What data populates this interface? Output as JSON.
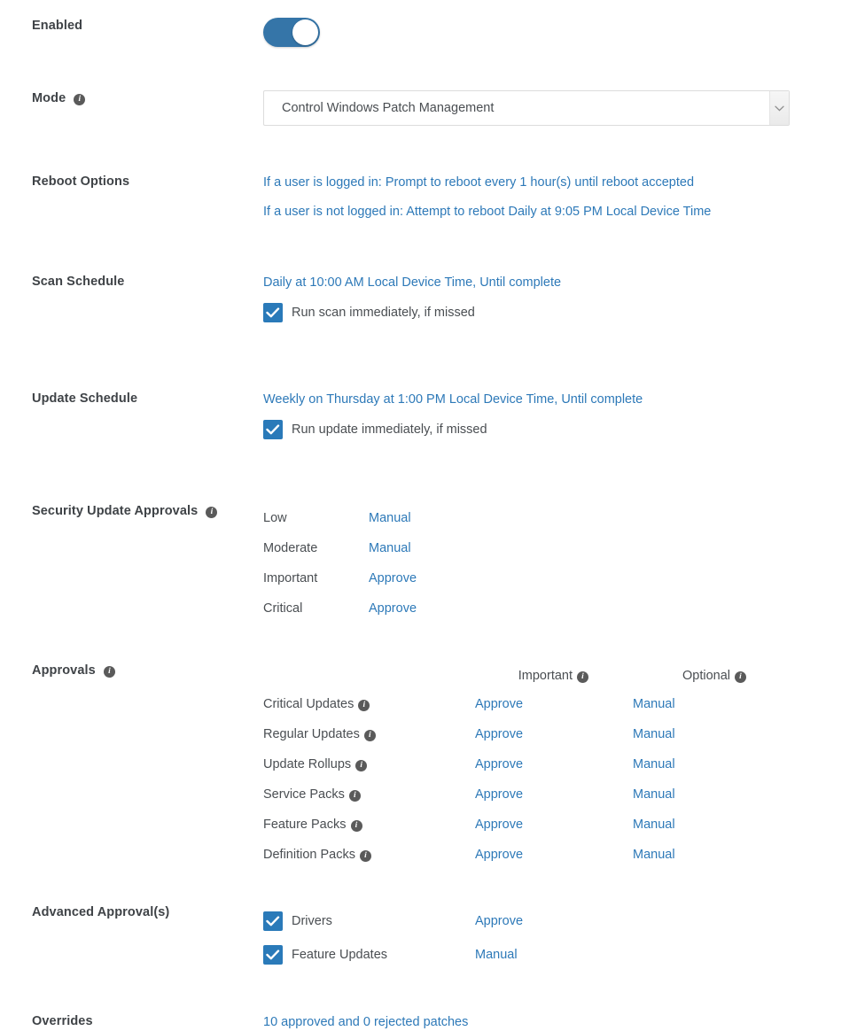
{
  "colors": {
    "link": "#2d79b8",
    "toggle_on": "#3575a8",
    "checkbox": "#2a7ab9",
    "label": "#3f4347",
    "info_icon": "#5a5a5a"
  },
  "icons": {
    "info": "info-icon",
    "chevron_down": "chevron-down-icon",
    "checkmark": "checkmark-icon"
  },
  "sections": {
    "enabled": {
      "label": "Enabled",
      "toggle_state": "on"
    },
    "mode": {
      "label": "Mode",
      "has_info": true,
      "selected": "Control Windows Patch Management"
    },
    "reboot_options": {
      "label": "Reboot Options",
      "lines": [
        "If a user is logged in: Prompt to reboot every 1 hour(s) until reboot accepted",
        "If a user is not logged in: Attempt to reboot Daily at 9:05 PM Local Device Time"
      ]
    },
    "scan_schedule": {
      "label": "Scan Schedule",
      "schedule": "Daily at 10:00 AM Local Device Time, Until complete",
      "checkbox_label": "Run scan immediately, if missed",
      "checkbox_checked": true
    },
    "update_schedule": {
      "label": "Update Schedule",
      "schedule": "Weekly on Thursday at 1:00 PM Local Device Time, Until complete",
      "checkbox_label": "Run update immediately, if missed",
      "checkbox_checked": true
    },
    "security_update_approvals": {
      "label": "Security Update Approvals",
      "has_info": true,
      "rows": [
        {
          "severity": "Low",
          "action": "Manual"
        },
        {
          "severity": "Moderate",
          "action": "Manual"
        },
        {
          "severity": "Important",
          "action": "Approve"
        },
        {
          "severity": "Critical",
          "action": "Approve"
        }
      ]
    },
    "approvals": {
      "label": "Approvals",
      "has_info": true,
      "headers": [
        {
          "text": "Important",
          "has_info": true
        },
        {
          "text": "Optional",
          "has_info": true
        }
      ],
      "rows": [
        {
          "name": "Critical Updates",
          "has_info": true,
          "important": "Approve",
          "optional": "Manual"
        },
        {
          "name": "Regular Updates",
          "has_info": true,
          "important": "Approve",
          "optional": "Manual"
        },
        {
          "name": "Update Rollups",
          "has_info": true,
          "important": "Approve",
          "optional": "Manual"
        },
        {
          "name": "Service Packs",
          "has_info": true,
          "important": "Approve",
          "optional": "Manual"
        },
        {
          "name": "Feature Packs",
          "has_info": true,
          "important": "Approve",
          "optional": "Manual"
        },
        {
          "name": "Definition Packs",
          "has_info": true,
          "important": "Approve",
          "optional": "Manual"
        }
      ]
    },
    "advanced_approvals": {
      "label": "Advanced Approval(s)",
      "has_info": false,
      "rows": [
        {
          "name": "Drivers",
          "checked": true,
          "action": "Approve"
        },
        {
          "name": "Feature Updates",
          "checked": true,
          "action": "Manual"
        }
      ]
    },
    "overrides": {
      "label": "Overrides",
      "summary": "10 approved and 0 rejected patches"
    }
  }
}
